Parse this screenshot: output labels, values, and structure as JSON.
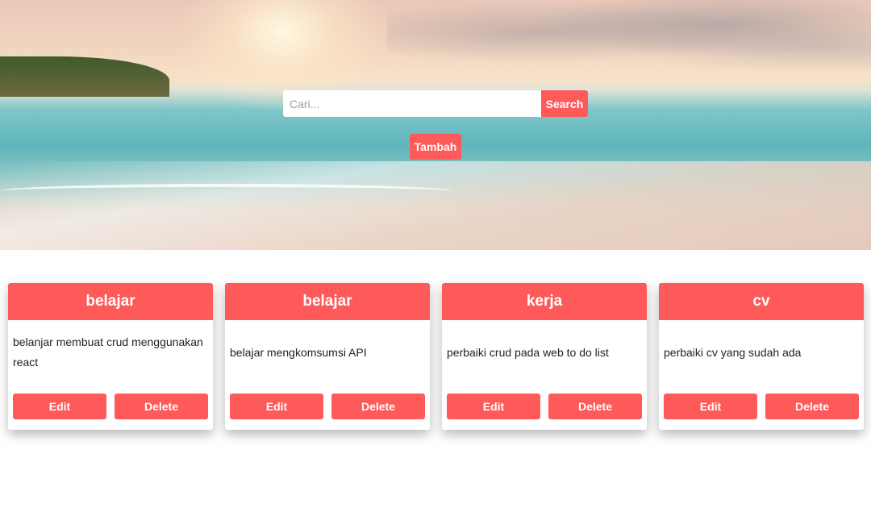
{
  "search": {
    "placeholder": "Cari...",
    "button_label": "Search"
  },
  "add_button_label": "Tambah",
  "cards": [
    {
      "title": "belajar",
      "description": "belanjar membuat crud menggunakan react",
      "edit_label": "Edit",
      "delete_label": "Delete"
    },
    {
      "title": "belajar",
      "description": "belajar mengkomsumsi API",
      "edit_label": "Edit",
      "delete_label": "Delete"
    },
    {
      "title": "kerja",
      "description": "perbaiki crud pada web to do list",
      "edit_label": "Edit",
      "delete_label": "Delete"
    },
    {
      "title": "cv",
      "description": "perbaiki cv yang sudah ada",
      "edit_label": "Edit",
      "delete_label": "Delete"
    }
  ],
  "colors": {
    "accent": "#ff5a5a",
    "card_background": "#ffffff"
  }
}
